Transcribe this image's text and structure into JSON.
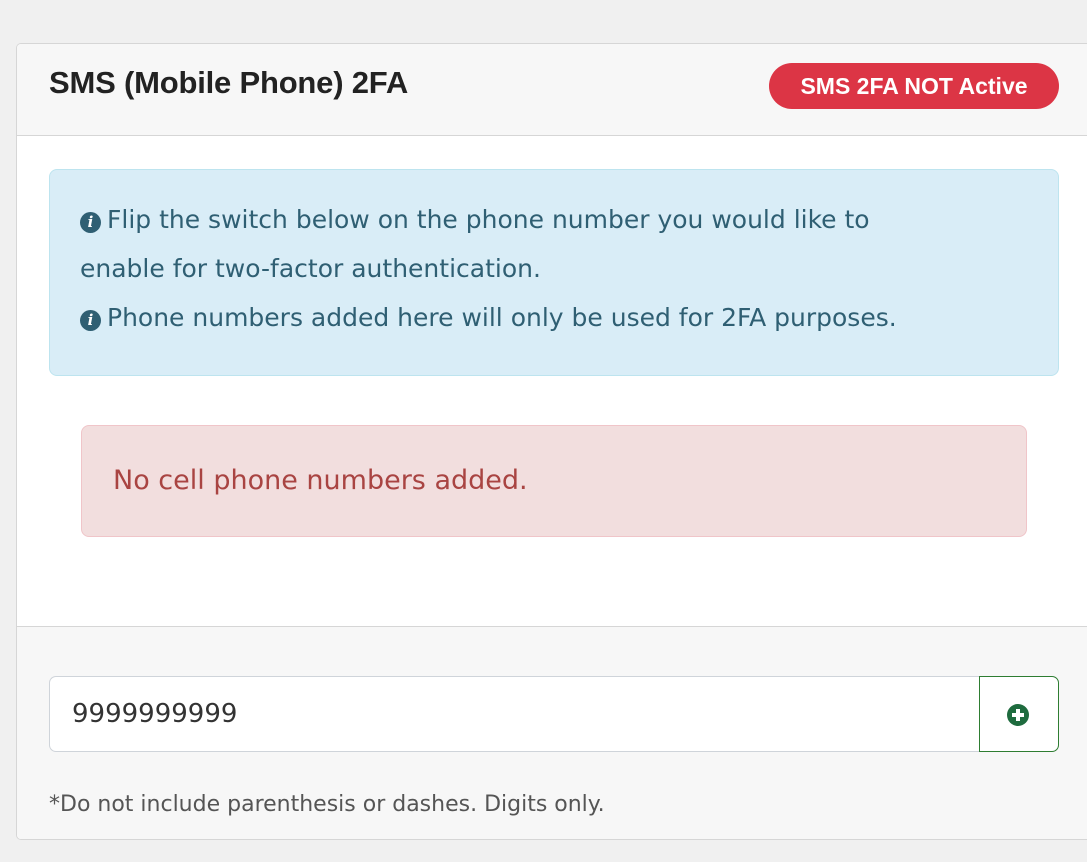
{
  "card": {
    "title": "SMS (Mobile Phone) 2FA",
    "status_badge": "SMS 2FA NOT Active"
  },
  "info_alert": {
    "icon": "info-circle-icon",
    "line1": "Flip the switch below on the phone number you would like to",
    "line2": "enable for two-factor authentication.",
    "line3": "Phone numbers added here will only be used for 2FA purposes."
  },
  "danger_alert": {
    "message": "No cell phone numbers added."
  },
  "footer": {
    "phone_input_value": "9999999999",
    "add_button_icon": "plus-circle-icon",
    "help_text": "*Do not include parenthesis or dashes. Digits only."
  },
  "colors": {
    "badge_bg": "#dc3545",
    "info_bg": "#d9edf7",
    "info_icon": "#2f5f73",
    "danger_bg": "#f2dede",
    "danger_text": "#a94442",
    "success": "#1e6b3e"
  }
}
